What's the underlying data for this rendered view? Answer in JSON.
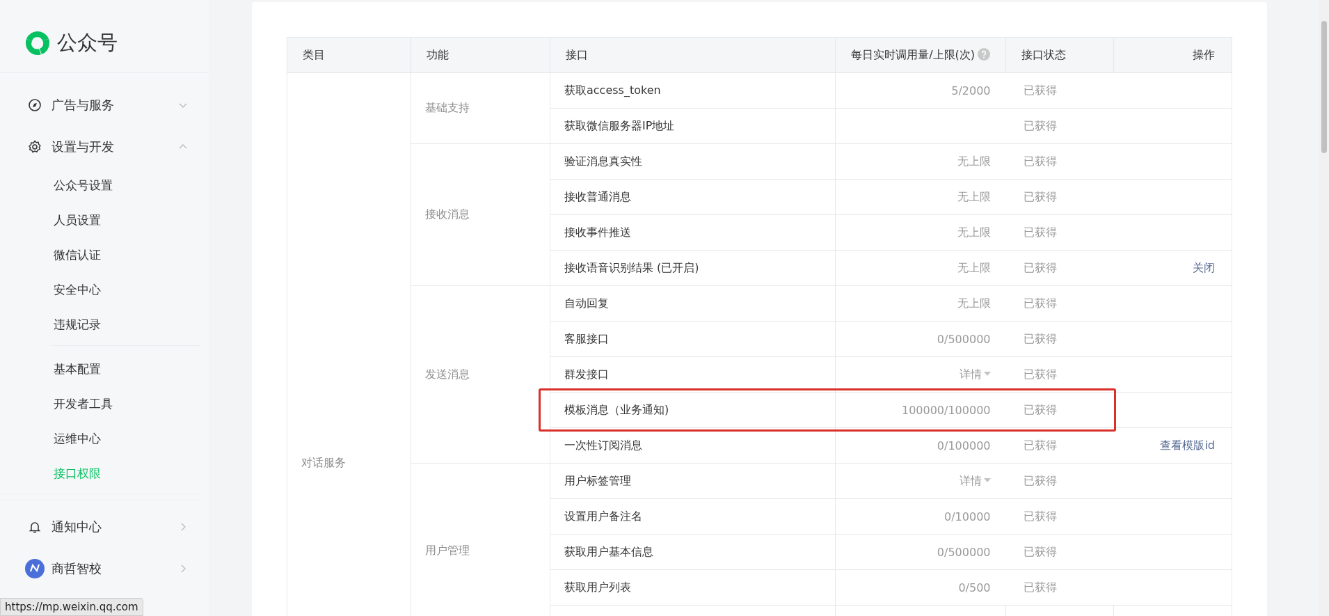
{
  "logo": {
    "title": "公众号"
  },
  "sidebar": {
    "items": [
      {
        "label": "广告与服务",
        "kind": "compass",
        "expanded": false
      },
      {
        "label": "设置与开发",
        "kind": "gear",
        "expanded": true,
        "sections": [
          {
            "children": [
              {
                "label": "公众号设置",
                "selected": false
              },
              {
                "label": "人员设置",
                "selected": false
              },
              {
                "label": "微信认证",
                "selected": false
              },
              {
                "label": "安全中心",
                "selected": false
              },
              {
                "label": "违规记录",
                "selected": false
              }
            ]
          },
          {
            "children": [
              {
                "label": "基本配置",
                "selected": false
              },
              {
                "label": "开发者工具",
                "selected": false
              },
              {
                "label": "运维中心",
                "selected": false
              },
              {
                "label": "接口权限",
                "selected": true
              }
            ]
          }
        ]
      },
      {
        "label": "通知中心",
        "kind": "bell",
        "expanded": false
      },
      {
        "label": "商哲智校",
        "kind": "avatar",
        "expanded": false
      }
    ]
  },
  "table": {
    "columns": [
      "类目",
      "功能",
      "接口",
      "每日实时调用量/上限(次)",
      "接口状态",
      "操作"
    ],
    "category": "对话服务",
    "groups": [
      {
        "function": "基础支持",
        "rows": [
          {
            "interface": "获取access_token",
            "usage": "5/2000",
            "status": "已获得"
          },
          {
            "interface": "获取微信服务器IP地址",
            "status": "已获得"
          }
        ]
      },
      {
        "function": "接收消息",
        "rows": [
          {
            "interface": "验证消息真实性",
            "usage": "无上限",
            "status": "已获得"
          },
          {
            "interface": "接收普通消息",
            "usage": "无上限",
            "status": "已获得"
          },
          {
            "interface": "接收事件推送",
            "usage": "无上限",
            "status": "已获得"
          },
          {
            "interface": "接收语音识别结果 (已开启)",
            "usage": "无上限",
            "status": "已获得",
            "action": "关闭"
          }
        ]
      },
      {
        "function": "发送消息",
        "rows": [
          {
            "interface": "自动回复",
            "usage": "无上限",
            "status": "已获得"
          },
          {
            "interface": "客服接口",
            "usage": "0/500000",
            "status": "已获得"
          },
          {
            "interface": "群发接口",
            "usage": "详情",
            "kind": "dropdown",
            "status": "已获得"
          },
          {
            "interface": "模板消息（业务通知)",
            "usage": "100000/100000",
            "status": "已获得",
            "highlighted": true
          },
          {
            "interface": "一次性订阅消息",
            "usage": "0/100000",
            "status": "已获得",
            "action": "查看模版id"
          }
        ]
      },
      {
        "function": "用户管理",
        "rows": [
          {
            "interface": "用户标签管理",
            "usage": "详情",
            "kind": "dropdown",
            "status": "已获得"
          },
          {
            "interface": "设置用户备注名",
            "usage": "0/10000",
            "status": "已获得"
          },
          {
            "interface": "获取用户基本信息",
            "usage": "0/500000",
            "status": "已获得"
          },
          {
            "interface": "获取用户列表",
            "usage": "0/500",
            "status": "已获得"
          }
        ]
      }
    ]
  },
  "status_bar": {
    "url": "https://mp.weixin.qq.com"
  }
}
